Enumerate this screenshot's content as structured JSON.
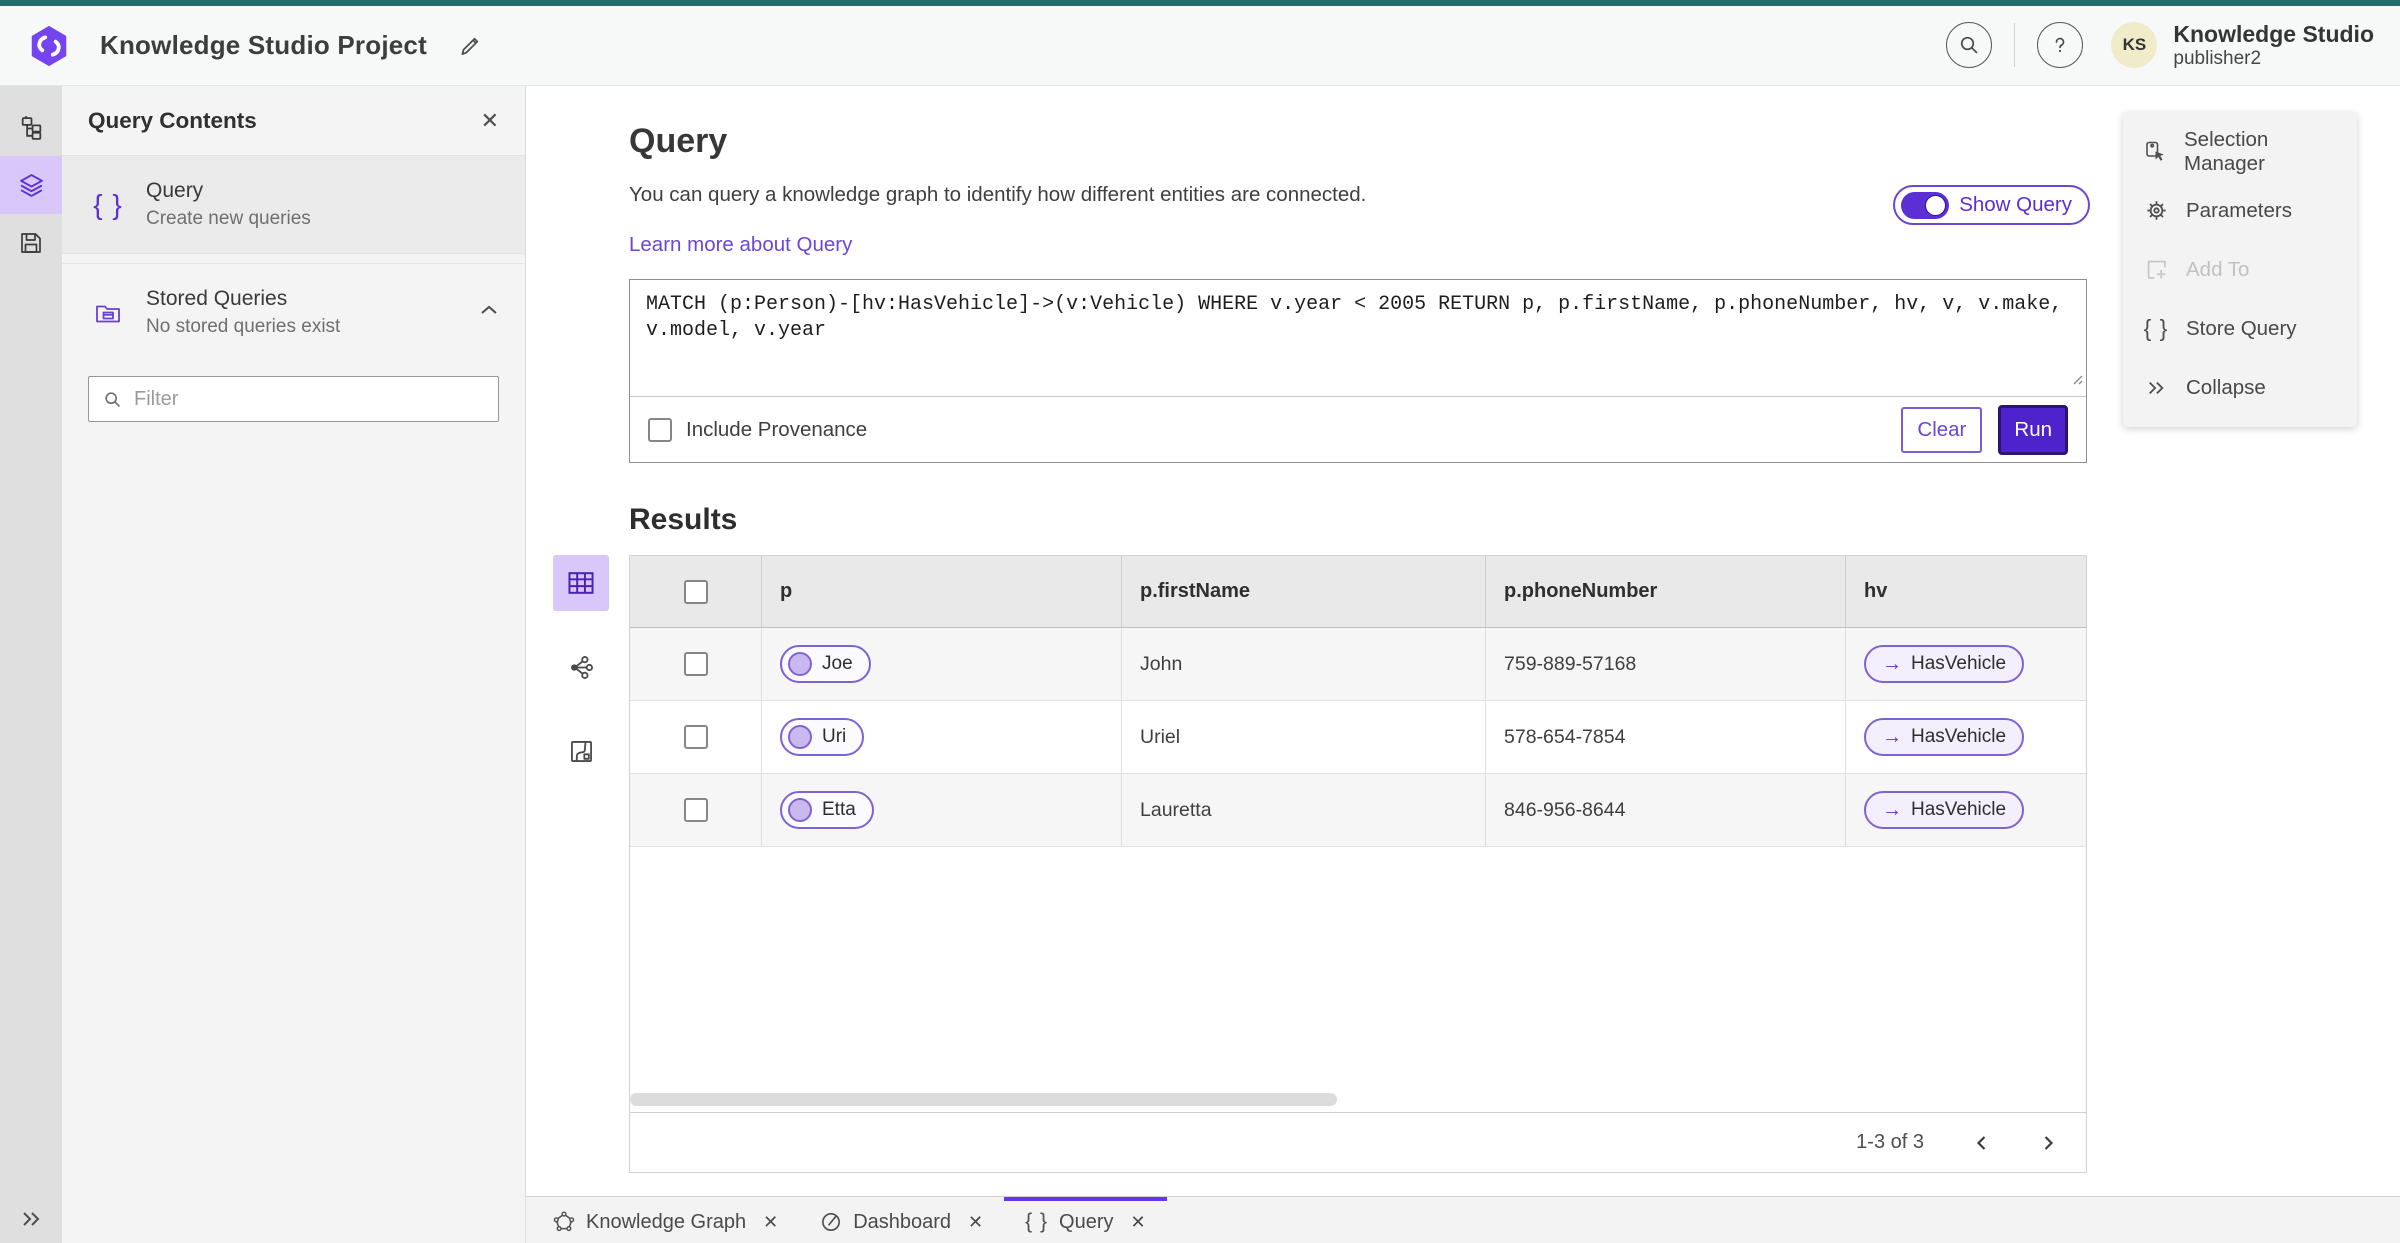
{
  "topbar": {
    "title": "Knowledge Studio Project",
    "user_name": "Knowledge Studio",
    "user_role": "publisher2",
    "avatar_initials": "KS"
  },
  "left_panel": {
    "title": "Query Contents",
    "query_item": {
      "label": "Query",
      "description": "Create new queries"
    },
    "stored_item": {
      "label": "Stored Queries",
      "description": "No stored queries exist"
    },
    "filter_placeholder": "Filter"
  },
  "query_section": {
    "title": "Query",
    "description": "You can query a knowledge graph to identify how different entities are connected.",
    "link": "Learn more about Query",
    "show_query_label": "Show Query",
    "query_text": "MATCH (p:Person)-[hv:HasVehicle]->(v:Vehicle) WHERE v.year < 2005 RETURN p, p.firstName, p.phoneNumber, hv, v, v.make, v.model, v.year",
    "include_provenance_label": "Include Provenance",
    "clear_label": "Clear",
    "run_label": "Run"
  },
  "side_menu": {
    "items": [
      {
        "label": "Selection Manager",
        "icon": "selection-manager-icon",
        "disabled": false
      },
      {
        "label": "Parameters",
        "icon": "gear-icon",
        "disabled": false
      },
      {
        "label": "Add To",
        "icon": "add-to-icon",
        "disabled": true
      },
      {
        "label": "Store Query",
        "icon": "braces-icon",
        "disabled": false
      },
      {
        "label": "Collapse",
        "icon": "double-chevron-right-icon",
        "disabled": false
      }
    ]
  },
  "results": {
    "title": "Results",
    "columns": [
      "p",
      "p.firstName",
      "p.phoneNumber",
      "hv"
    ],
    "rows": [
      {
        "p": "Joe",
        "firstName": "John",
        "phone": "759-889-57168",
        "hv": "HasVehicle"
      },
      {
        "p": "Uri",
        "firstName": "Uriel",
        "phone": "578-654-7854",
        "hv": "HasVehicle"
      },
      {
        "p": "Etta",
        "firstName": "Lauretta",
        "phone": "846-956-8644",
        "hv": "HasVehicle"
      }
    ],
    "pagination": "1-3 of 3",
    "edge_arrow": "→"
  },
  "tabs": [
    {
      "label": "Knowledge Graph",
      "icon": "knowledge-graph-icon",
      "active": false
    },
    {
      "label": "Dashboard",
      "icon": "dashboard-icon",
      "active": false
    },
    {
      "label": "Query",
      "icon": "braces-icon",
      "active": true
    }
  ],
  "colors": {
    "accent_purple": "#5b2ed6",
    "run_button": "#4e23cb",
    "teal_top": "#266a6c",
    "selected_icon_bg": "#d8c7f8",
    "avatar_bg": "#f0ecca",
    "link": "#6a47d4"
  }
}
